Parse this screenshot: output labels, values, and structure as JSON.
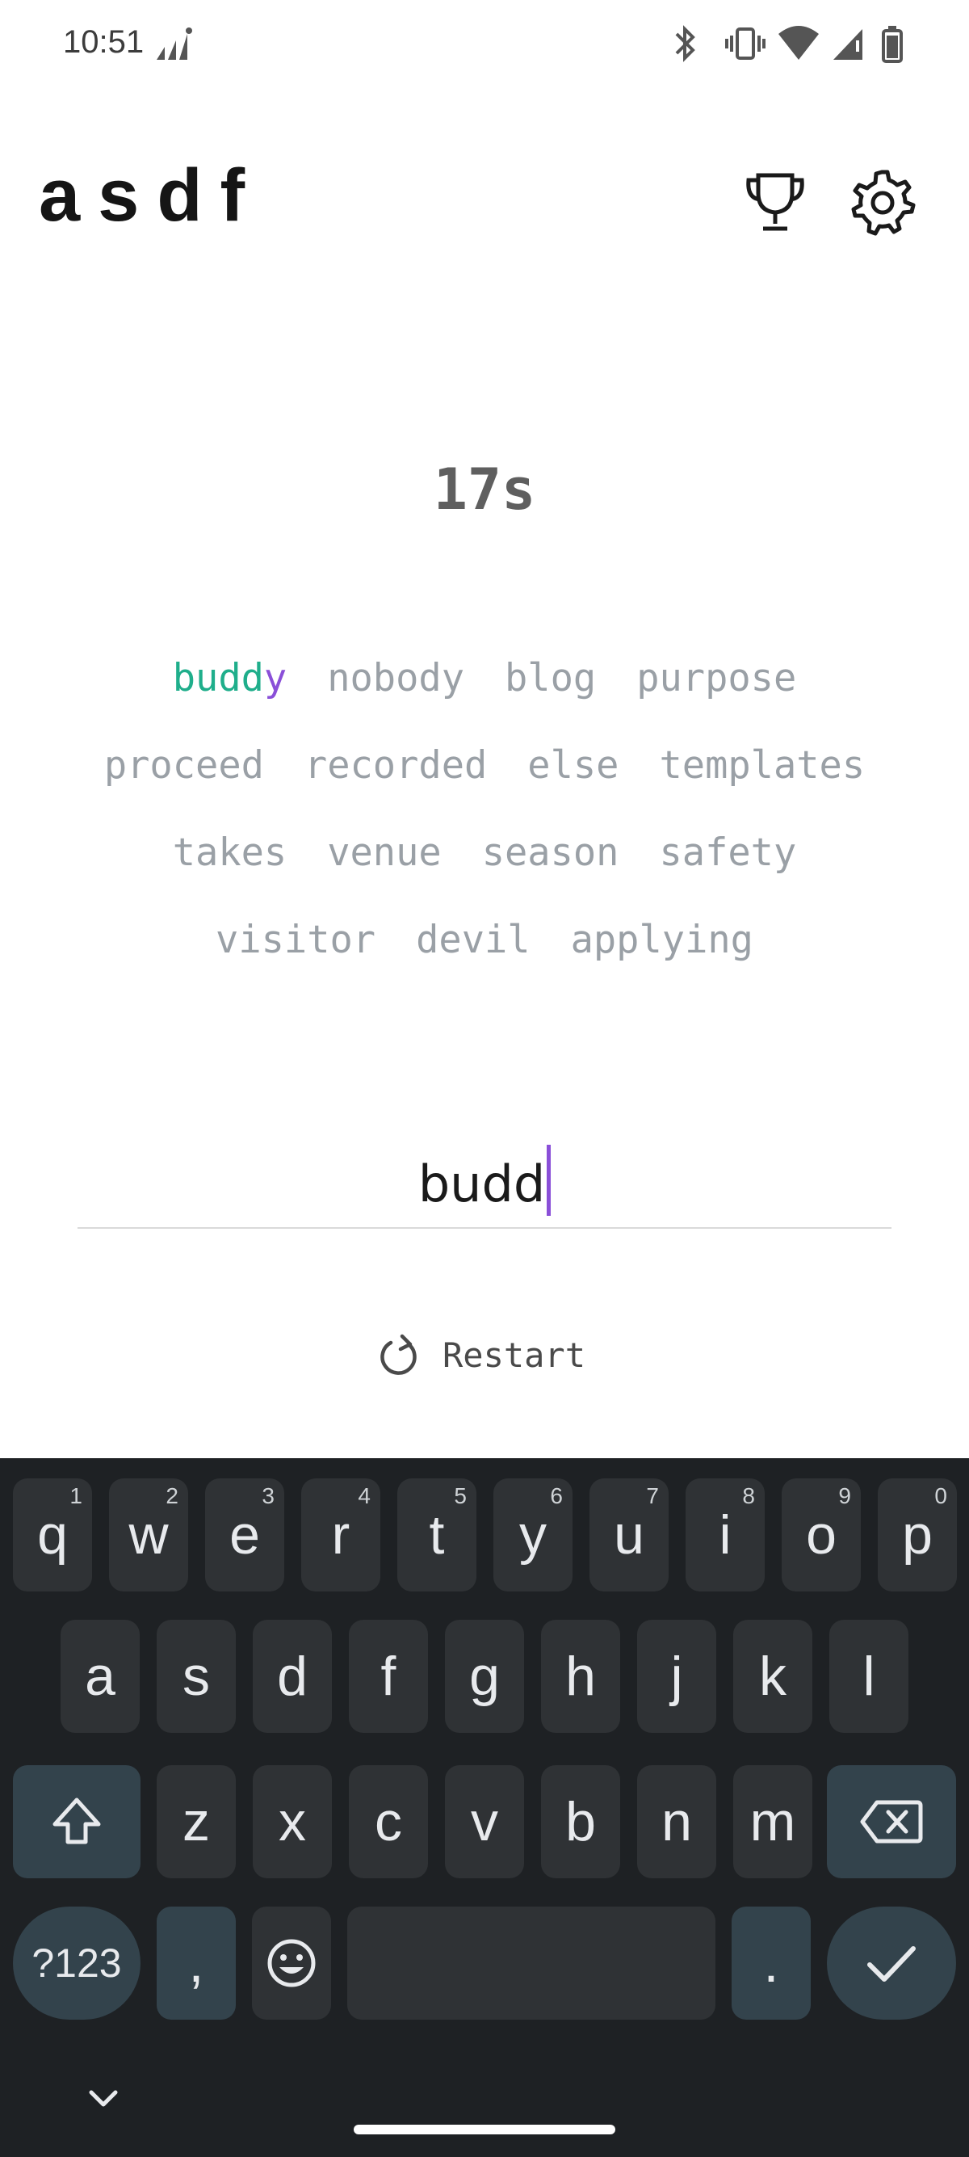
{
  "status_bar": {
    "time": "10:51",
    "icons": [
      "signal-activity-icon",
      "bluetooth-icon",
      "vibrate-icon",
      "wifi-icon",
      "cell-signal-icon",
      "battery-icon"
    ]
  },
  "app": {
    "logo": "asdf",
    "header_icons": [
      "trophy-icon",
      "gear-icon"
    ]
  },
  "timer": {
    "label": "17s"
  },
  "words": {
    "current": {
      "typed": "budd",
      "next": "y"
    },
    "lines": [
      [
        "nobody",
        "blog",
        "purpose"
      ],
      [
        "proceed",
        "recorded",
        "else",
        "templates"
      ],
      [
        "takes",
        "venue",
        "season",
        "safety"
      ],
      [
        "visitor",
        "devil",
        "applying"
      ]
    ]
  },
  "input": {
    "value": "budd"
  },
  "restart": {
    "label": "Restart",
    "icon": "restart-icon"
  },
  "keyboard": {
    "row1": [
      {
        "k": "q",
        "h": "1"
      },
      {
        "k": "w",
        "h": "2"
      },
      {
        "k": "e",
        "h": "3"
      },
      {
        "k": "r",
        "h": "4"
      },
      {
        "k": "t",
        "h": "5"
      },
      {
        "k": "y",
        "h": "6"
      },
      {
        "k": "u",
        "h": "7"
      },
      {
        "k": "i",
        "h": "8"
      },
      {
        "k": "o",
        "h": "9"
      },
      {
        "k": "p",
        "h": "0"
      }
    ],
    "row2": [
      "a",
      "s",
      "d",
      "f",
      "g",
      "h",
      "j",
      "k",
      "l"
    ],
    "row3": [
      "z",
      "x",
      "c",
      "v",
      "b",
      "n",
      "m"
    ],
    "symbols": "?123",
    "comma": ",",
    "period": ".",
    "icons": [
      "shift-icon",
      "backspace-icon",
      "emoji-icon",
      "enter-check-icon",
      "chevron-down-icon"
    ]
  },
  "colors": {
    "typed": "#1fae8b",
    "next_char": "#8a4fd8",
    "pending": "#9aa0a6",
    "keyboard_bg": "#1e2124",
    "key_bg": "#2f3235",
    "func_key_bg": "#33434c"
  }
}
